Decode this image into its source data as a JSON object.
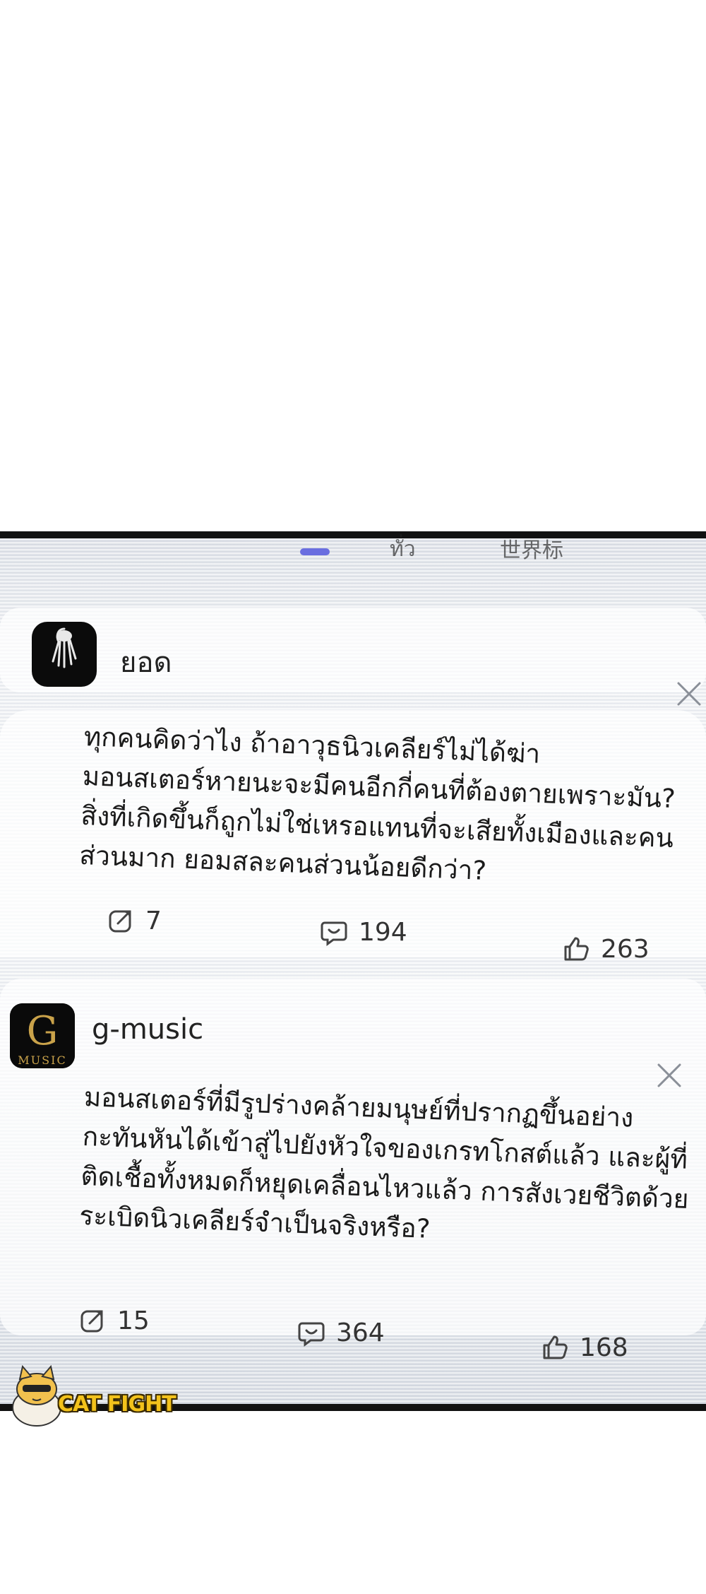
{
  "tabs": {
    "partial_labels": [
      "ทั่ว",
      "世界标"
    ]
  },
  "posts": [
    {
      "username": "ยอด",
      "text": "ทุกคนคิดว่าไง ถ้าอาวุธนิวเคลียร์ไม่ได้ฆ่า\nมอนสเตอร์หายนะจะมีคนอีกกี่คนที่ต้องตายเพราะมัน?\nสิ่งที่เกิดขึ้นก็ถูกไม่ใช่เหรอแทนที่จะเสียทั้งเมืองและคน\nส่วนมาก ยอมสละคนส่วนน้อยดีกว่า?",
      "shares": "7",
      "comments": "194",
      "likes": "263",
      "avatar_icon": "hand-icon"
    },
    {
      "username": "g-music",
      "text": "มอนสเตอร์ที่มีรูปร่างคล้ายมนุษย์ที่ปรากฏขึ้นอย่าง\nกะทันหันได้เข้าสู่ไปยังหัวใจของเกรทโกสต์แล้ว และผู้ที่\nติดเชื้อทั้งหมดก็หยุดเคลื่อนไหวแล้ว การสังเวยชีวิตด้วย\nระเบิดนิวเคลียร์จำเป็นจริงหรือ?",
      "shares": "15",
      "comments": "364",
      "likes": "168",
      "avatar_logo_letter": "G",
      "avatar_logo_sub": "MUSIC"
    }
  ],
  "watermark": {
    "text": "CAT FIGHT"
  },
  "colors": {
    "accent": "#6a6ee0",
    "text": "#1a1a1a",
    "watermark": "#f3c21b"
  }
}
